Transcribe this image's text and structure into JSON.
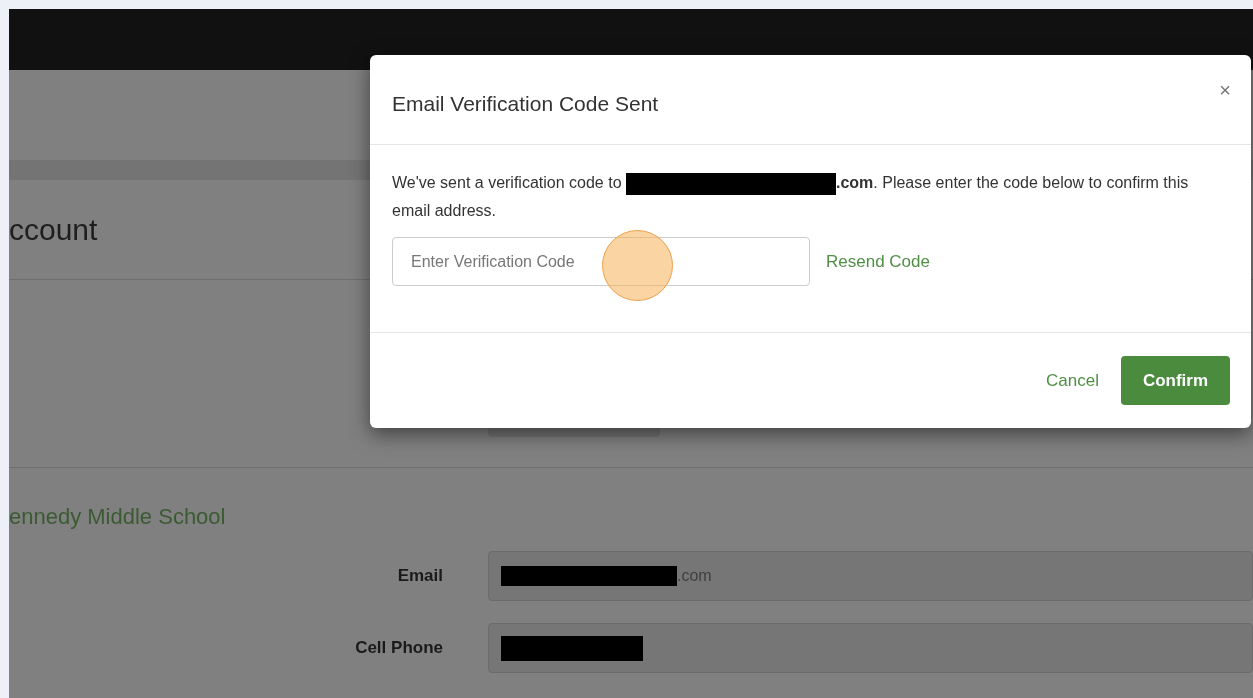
{
  "page": {
    "heading": "ccount",
    "school": "ennedy Middle School",
    "fields": [
      {
        "label": "Email",
        "value": ".com",
        "redacted": true
      },
      {
        "label": "Cell Phone",
        "redacted": true
      }
    ]
  },
  "dialog": {
    "title": "Email Verification Code Sent",
    "close": "×",
    "message": {
      "before": "We've sent a verification code to ",
      "email_redacted": true,
      "email_tail": ".com",
      "after": ". Please enter the code below to confirm this email address."
    },
    "code_field": {
      "placeholder": "Enter Verification Code"
    },
    "resend": "Resend Code",
    "cancel": "Cancel",
    "confirm": "Confirm"
  }
}
